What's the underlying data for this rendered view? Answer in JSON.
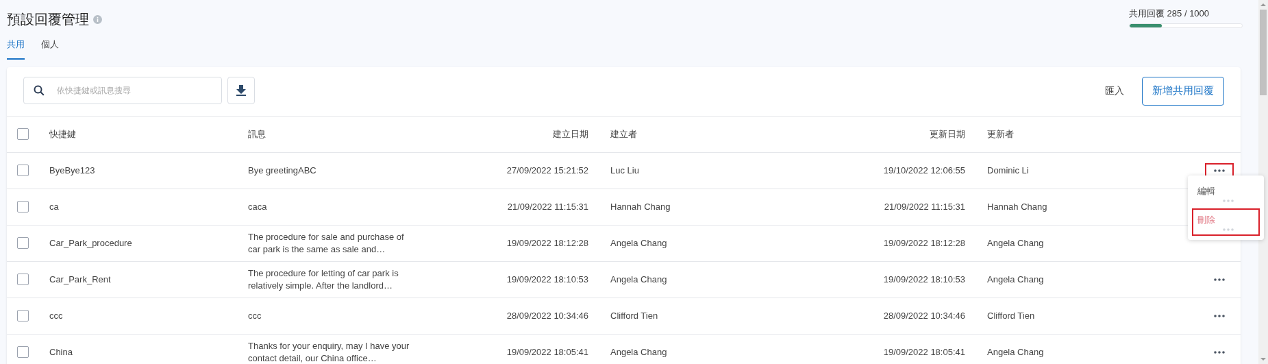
{
  "title": "預設回覆管理",
  "tabs": [
    {
      "label": "共用",
      "selected": true
    },
    {
      "label": "個人",
      "selected": false
    }
  ],
  "quota": {
    "label": "共用回覆 285 / 1000",
    "level": 0.285
  },
  "toolbar": {
    "search": {
      "placeholder": "依快捷鍵或訊息搜尋"
    },
    "import": "匯入",
    "add": "新增共用回覆"
  },
  "table": {
    "all_checked": false,
    "columns": [
      "快捷鍵",
      "訊息",
      "建立日期",
      "建立者",
      "更新日期",
      "更新者"
    ],
    "rows": [
      {
        "checked": false,
        "cells": [
          "ByeBye123",
          "Bye greetingABC",
          "27/09/2022 15:21:52",
          "Luc Liu",
          "19/10/2022 12:06:55",
          "Dominic Li"
        ],
        "actions": {
          "highlighted": true
        }
      },
      {
        "checked": false,
        "cells": [
          "ca",
          "caca",
          "21/09/2022 11:15:31",
          "Hannah Chang",
          "21/09/2022 11:15:31",
          "Hannah Chang"
        ]
      },
      {
        "checked": false,
        "cells": [
          "Car_Park_procedure",
          "The procedure for sale and purchase of car park is the same as sale and…",
          "19/09/2022 18:12:28",
          "Angela Chang",
          "19/09/2022 18:12:28",
          "Angela Chang"
        ]
      },
      {
        "checked": false,
        "cells": [
          "Car_Park_Rent",
          "The procedure for letting of car park is relatively simple. After the landlord…",
          "19/09/2022 18:10:53",
          "Angela Chang",
          "19/09/2022 18:10:53",
          "Angela Chang"
        ],
        "actions": {
          "highlighted": false
        }
      },
      {
        "checked": false,
        "cells": [
          "ccc",
          "ccc",
          "28/09/2022 10:34:46",
          "Clifford Tien",
          "28/09/2022 10:34:46",
          "Clifford Tien"
        ],
        "actions": {
          "highlighted": false
        }
      },
      {
        "checked": false,
        "cells": [
          "China",
          "Thanks for your enquiry, may I have your contact detail, our China office…",
          "19/09/2022 18:05:41",
          "Angela Chang",
          "19/09/2022 18:05:41",
          "Angela Chang"
        ],
        "actions": {
          "highlighted": false
        }
      }
    ]
  },
  "menu": {
    "items": [
      {
        "label": "編輯",
        "kind": "normal",
        "highlighted": false
      },
      {
        "label": "刪除",
        "kind": "danger",
        "highlighted": true
      }
    ]
  }
}
